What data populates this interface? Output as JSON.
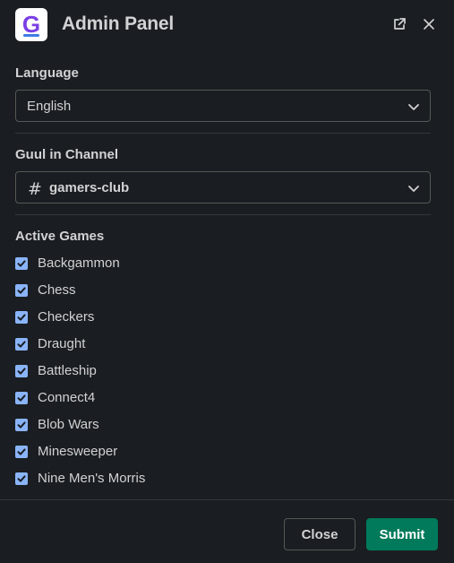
{
  "header": {
    "title": "Admin Panel",
    "logo_letter": "G",
    "icons": {
      "popout": "external-link-icon",
      "close": "close-icon"
    }
  },
  "language": {
    "label": "Language",
    "selected": "English"
  },
  "channel": {
    "label": "Guul in Channel",
    "prefix": "#",
    "selected": "gamers-club"
  },
  "games": {
    "label": "Active Games",
    "items": [
      {
        "label": "Backgammon",
        "checked": true
      },
      {
        "label": "Chess",
        "checked": true
      },
      {
        "label": "Checkers",
        "checked": true
      },
      {
        "label": "Draught",
        "checked": true
      },
      {
        "label": "Battleship",
        "checked": true
      },
      {
        "label": "Connect4",
        "checked": true
      },
      {
        "label": "Blob Wars",
        "checked": true
      },
      {
        "label": "Minesweeper",
        "checked": true
      },
      {
        "label": "Nine Men's Morris",
        "checked": true
      }
    ]
  },
  "footer": {
    "close_label": "Close",
    "submit_label": "Submit"
  },
  "colors": {
    "background": "#1a1d21",
    "text": "#d1d2d3",
    "checkbox": "#8ab4f8",
    "submit": "#007a5a",
    "logo_purple": "#7b3fe4",
    "logo_blue": "#3d7be4"
  }
}
